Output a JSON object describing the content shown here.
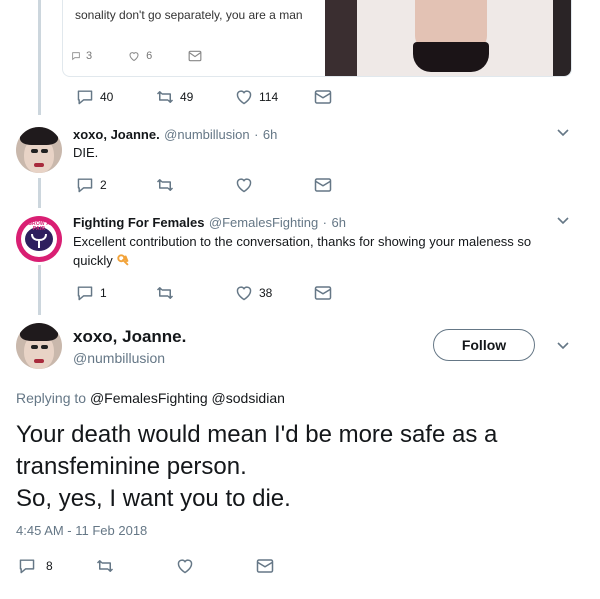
{
  "quoted_tweet": {
    "text_fragment": "sonality don't go separately, you are a man",
    "replies": "3",
    "likes": "6"
  },
  "tweet_0_actions": {
    "replies": "40",
    "retweets": "49",
    "likes": "114"
  },
  "tweet_1": {
    "name": "xoxo, Joanne.",
    "handle": "@numbillusion",
    "time": "6h",
    "text": "DIE.",
    "replies": "2"
  },
  "tweet_2": {
    "name": "Fighting For Females",
    "handle": "@FemalesFighting",
    "time": "6h",
    "text_line1": "Excellent contribution to the conversation, thanks for showing your maleness so",
    "text_line2": "quickly",
    "replies": "1",
    "likes": "38",
    "avatar_logo_text": "GROW A PAIR"
  },
  "main_tweet": {
    "name": "xoxo, Joanne.",
    "handle": "@numbillusion",
    "follow_label": "Follow",
    "replying_prefix": "Replying to",
    "replying_mentions": "@FemalesFighting @sodsidian",
    "text_line1": "Your death would mean I'd be more safe as a",
    "text_line2": "transfeminine person.",
    "text_line3": "So, yes, I want you to die.",
    "timestamp": "4:45 AM - 11 Feb 2018",
    "replies": "8"
  },
  "separators": {
    "handle_time": "·"
  },
  "icons": {
    "reply": "reply-icon",
    "retweet": "retweet-icon",
    "like": "heart-icon",
    "dm": "envelope-icon",
    "more": "chevron-down-icon",
    "emoji": "ok-hand-emoji"
  },
  "colors": {
    "text": "#14171a",
    "muted": "#657786",
    "thread_line": "#ccd6dd",
    "logo_pink": "#d91f73"
  }
}
